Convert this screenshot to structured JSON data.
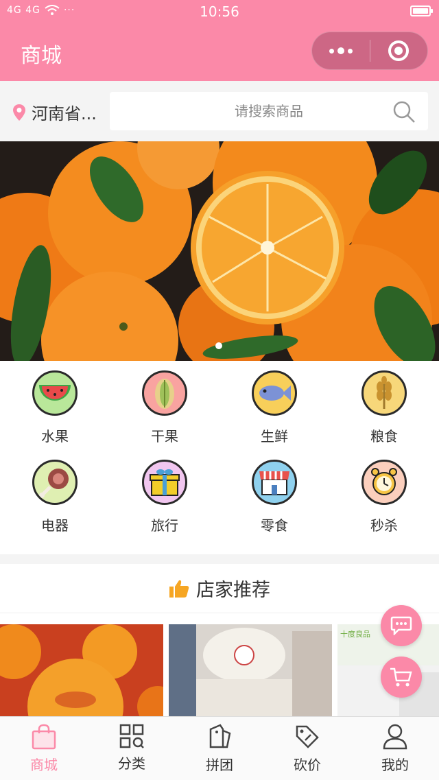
{
  "status_bar": {
    "signal": "4G 4G",
    "time": "10:56",
    "battery_level": 0.85
  },
  "nav": {
    "title": "商城"
  },
  "search": {
    "location": "河南省...",
    "placeholder": "请搜索商品"
  },
  "banner": {
    "slide_count": 1,
    "active_index": 0
  },
  "categories": [
    {
      "label": "水果",
      "icon": "watermelon-icon",
      "bg": "#b9e79a"
    },
    {
      "label": "干果",
      "icon": "pistachio-icon",
      "bg": "#f9a3a0"
    },
    {
      "label": "生鲜",
      "icon": "fish-icon",
      "bg": "#f8cf5a"
    },
    {
      "label": "粮食",
      "icon": "wheat-icon",
      "bg": "#f7d77a"
    },
    {
      "label": "电器",
      "icon": "meat-icon",
      "bg": "#dfefb2"
    },
    {
      "label": "旅行",
      "icon": "gift-icon",
      "bg": "#f1c6ef"
    },
    {
      "label": "零食",
      "icon": "store-icon",
      "bg": "#8fd1ee"
    },
    {
      "label": "秒杀",
      "icon": "alarm-clock-icon",
      "bg": "#fbcfbd"
    }
  ],
  "recommend": {
    "title": "店家推荐"
  },
  "products": [
    {
      "name": "oranges"
    },
    {
      "name": "snack-pack"
    },
    {
      "name": "food-pack",
      "brand_text": "十度良品"
    }
  ],
  "tabs": [
    {
      "label": "商城",
      "icon": "shopping-bag-icon",
      "active": true
    },
    {
      "label": "分类",
      "icon": "category-grid-icon",
      "active": false
    },
    {
      "label": "拼团",
      "icon": "group-tag-icon",
      "active": false
    },
    {
      "label": "砍价",
      "icon": "discount-tag-icon",
      "active": false
    },
    {
      "label": "我的",
      "icon": "user-icon",
      "active": false
    }
  ],
  "colors": {
    "accent": "#fb89a8"
  }
}
